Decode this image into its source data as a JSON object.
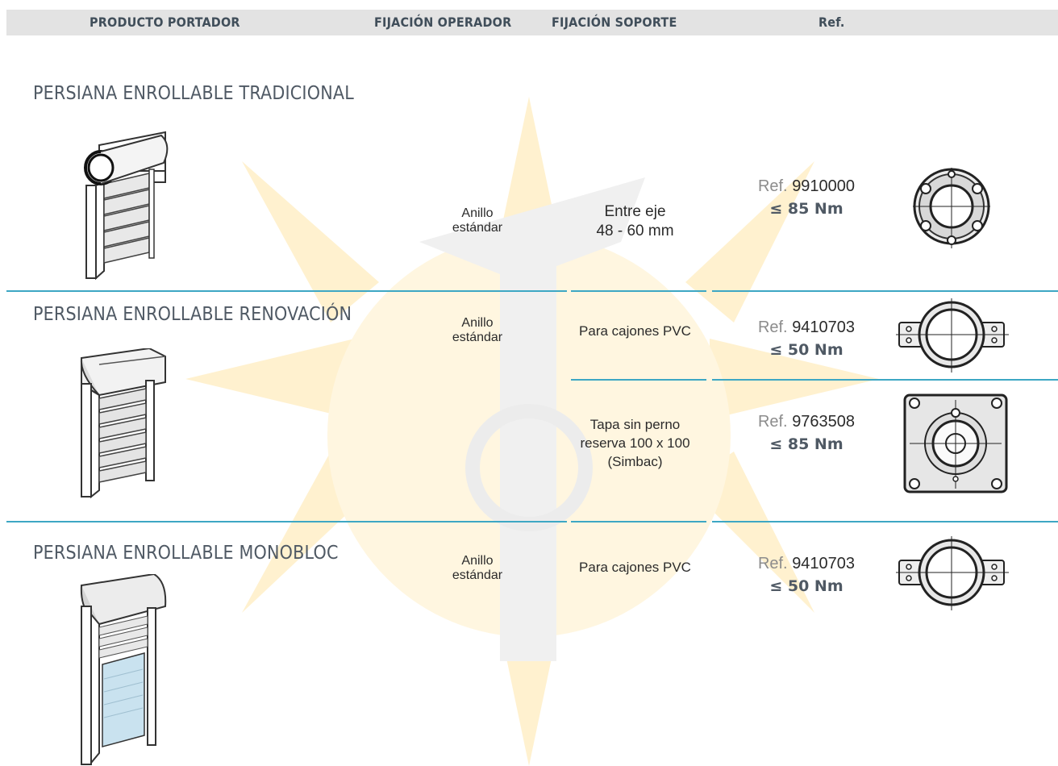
{
  "header": {
    "product": "PRODUCTO PORTADOR",
    "operator_fixing": "FIJACIÓN OPERADOR",
    "support_fixing": "FIJACIÓN SOPORTE",
    "ref": "Ref."
  },
  "sections": [
    {
      "title": "PERSIANA ENROLLABLE TRADICIONAL",
      "operator_line1": "Anillo",
      "operator_line2": "estándar",
      "rows": [
        {
          "support_line1": "Entre eje",
          "support_line2": "48 - 60 mm",
          "ref_label": "Ref.",
          "ref_number": "9910000",
          "torque": "≤ 85 Nm"
        }
      ]
    },
    {
      "title": "PERSIANA ENROLLABLE RENOVACIÓN",
      "operator_line1": "Anillo",
      "operator_line2": "estándar",
      "rows": [
        {
          "support_line1": "Para cajones PVC",
          "ref_label": "Ref.",
          "ref_number": "9410703",
          "torque": "≤ 50 Nm"
        },
        {
          "support_line1": "Tapa sin perno",
          "support_line2": "reserva 100 x 100",
          "support_line3": "(Simbac)",
          "ref_label": "Ref.",
          "ref_number": "9763508",
          "torque": "≤ 85 Nm"
        }
      ]
    },
    {
      "title": "PERSIANA ENROLLABLE MONOBLOC",
      "operator_line1": "Anillo",
      "operator_line2": "estándar",
      "rows": [
        {
          "support_line1": "Para cajones PVC",
          "ref_label": "Ref.",
          "ref_number": "9410703",
          "torque": "≤ 50 Nm"
        }
      ]
    }
  ],
  "colors": {
    "divider": "#3da7c4",
    "header_bg": "#e3e3e3",
    "header_text": "#404e5a",
    "watermark": "#fff0c8"
  }
}
